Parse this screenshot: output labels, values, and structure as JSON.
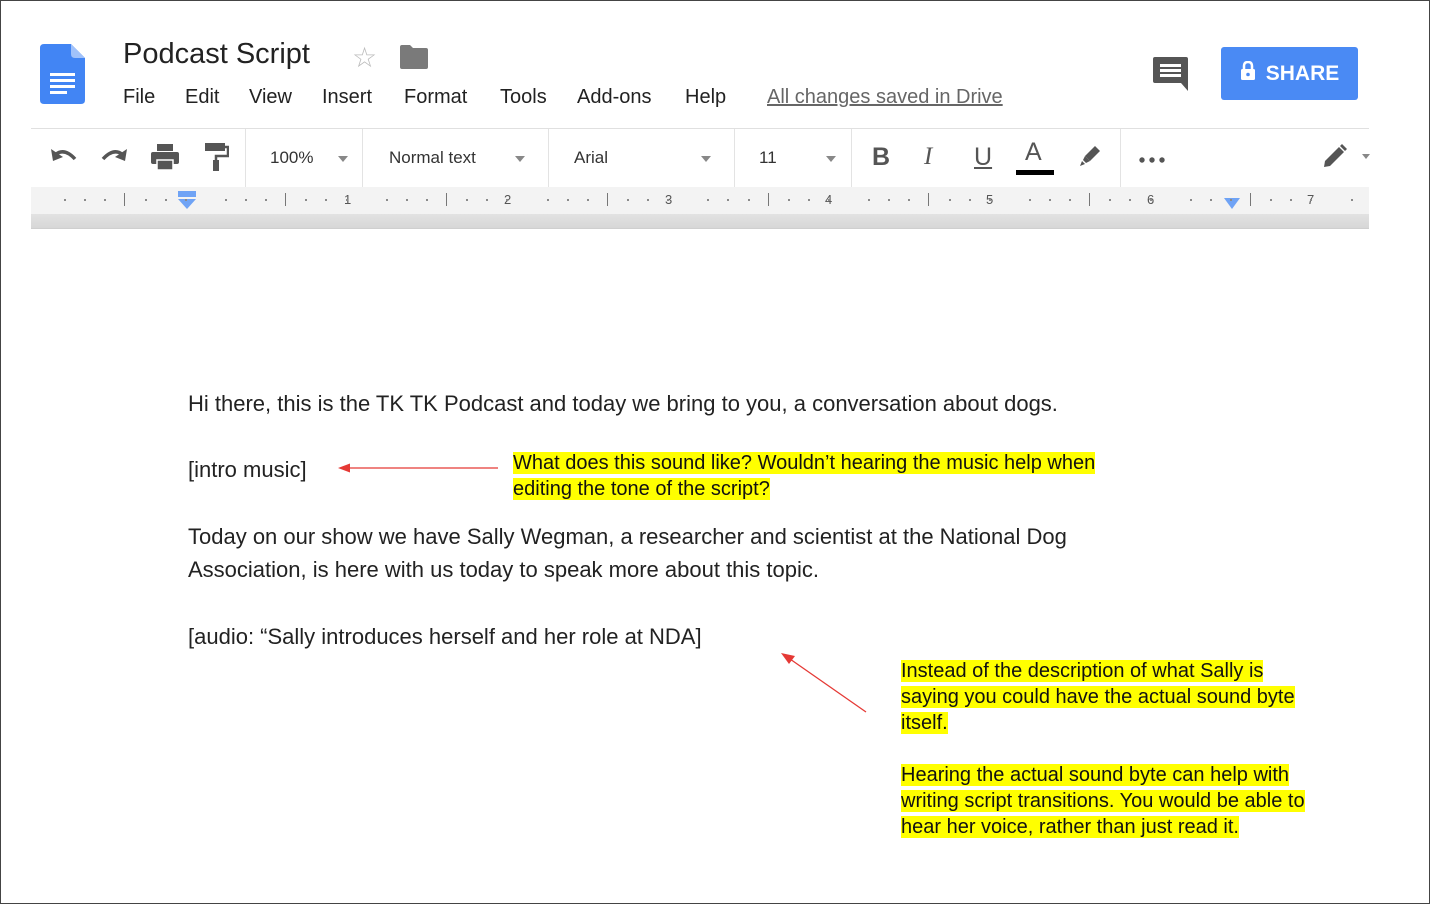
{
  "header": {
    "title": "Podcast Script",
    "saved_status": "All changes saved in Drive",
    "share_label": "SHARE",
    "icons": {
      "logo": "google-docs-icon",
      "star": "star-icon",
      "folder": "folder-icon",
      "comment": "comment-icon",
      "lock": "lock-icon"
    }
  },
  "menu": {
    "items": [
      "File",
      "Edit",
      "View",
      "Insert",
      "Format",
      "Tools",
      "Add-ons",
      "Help"
    ]
  },
  "toolbar": {
    "zoom": "100%",
    "style": "Normal text",
    "font": "Arial",
    "size": "11",
    "bold": "B",
    "italic": "I",
    "underline": "U",
    "text_color": "A",
    "text_color_value": "#000000",
    "icons": [
      "undo-icon",
      "redo-icon",
      "print-icon",
      "paint-format-icon",
      "highlighter-icon",
      "more-icon",
      "edit-mode-icon"
    ]
  },
  "ruler": {
    "numbers": [
      "1",
      "2",
      "3",
      "4",
      "5",
      "6",
      "7"
    ]
  },
  "document": {
    "lines": [
      "Hi there, this is the TK TK Podcast and today we bring to you, a conversation about dogs.",
      "[intro music]",
      "Today on our show we have Sally Wegman, a researcher and scientist at the National Dog",
      "Association, is here with us today to speak more about this topic.",
      "[audio: “Sally introduces herself and her role at NDA]"
    ]
  },
  "annotations": {
    "note1": {
      "line1": "What does this sound like? Wouldn’t hearing the music help when",
      "line2": "editing the tone of the script?"
    },
    "note2": {
      "para1_line1": "Instead of the description of what Sally is",
      "para1_line2": "saying you could have the actual sound byte",
      "para1_line3": "itself.",
      "para2_line1": "Hearing the actual sound byte can help with",
      "para2_line2": "writing script transitions. You would be able to",
      "para2_line3": "hear her voice, rather than just read it."
    },
    "highlight_color": "#ffff00",
    "arrow_color": "#e53935"
  },
  "colors": {
    "share_button": "#4a8af4",
    "docs_blue": "#4285f4"
  }
}
